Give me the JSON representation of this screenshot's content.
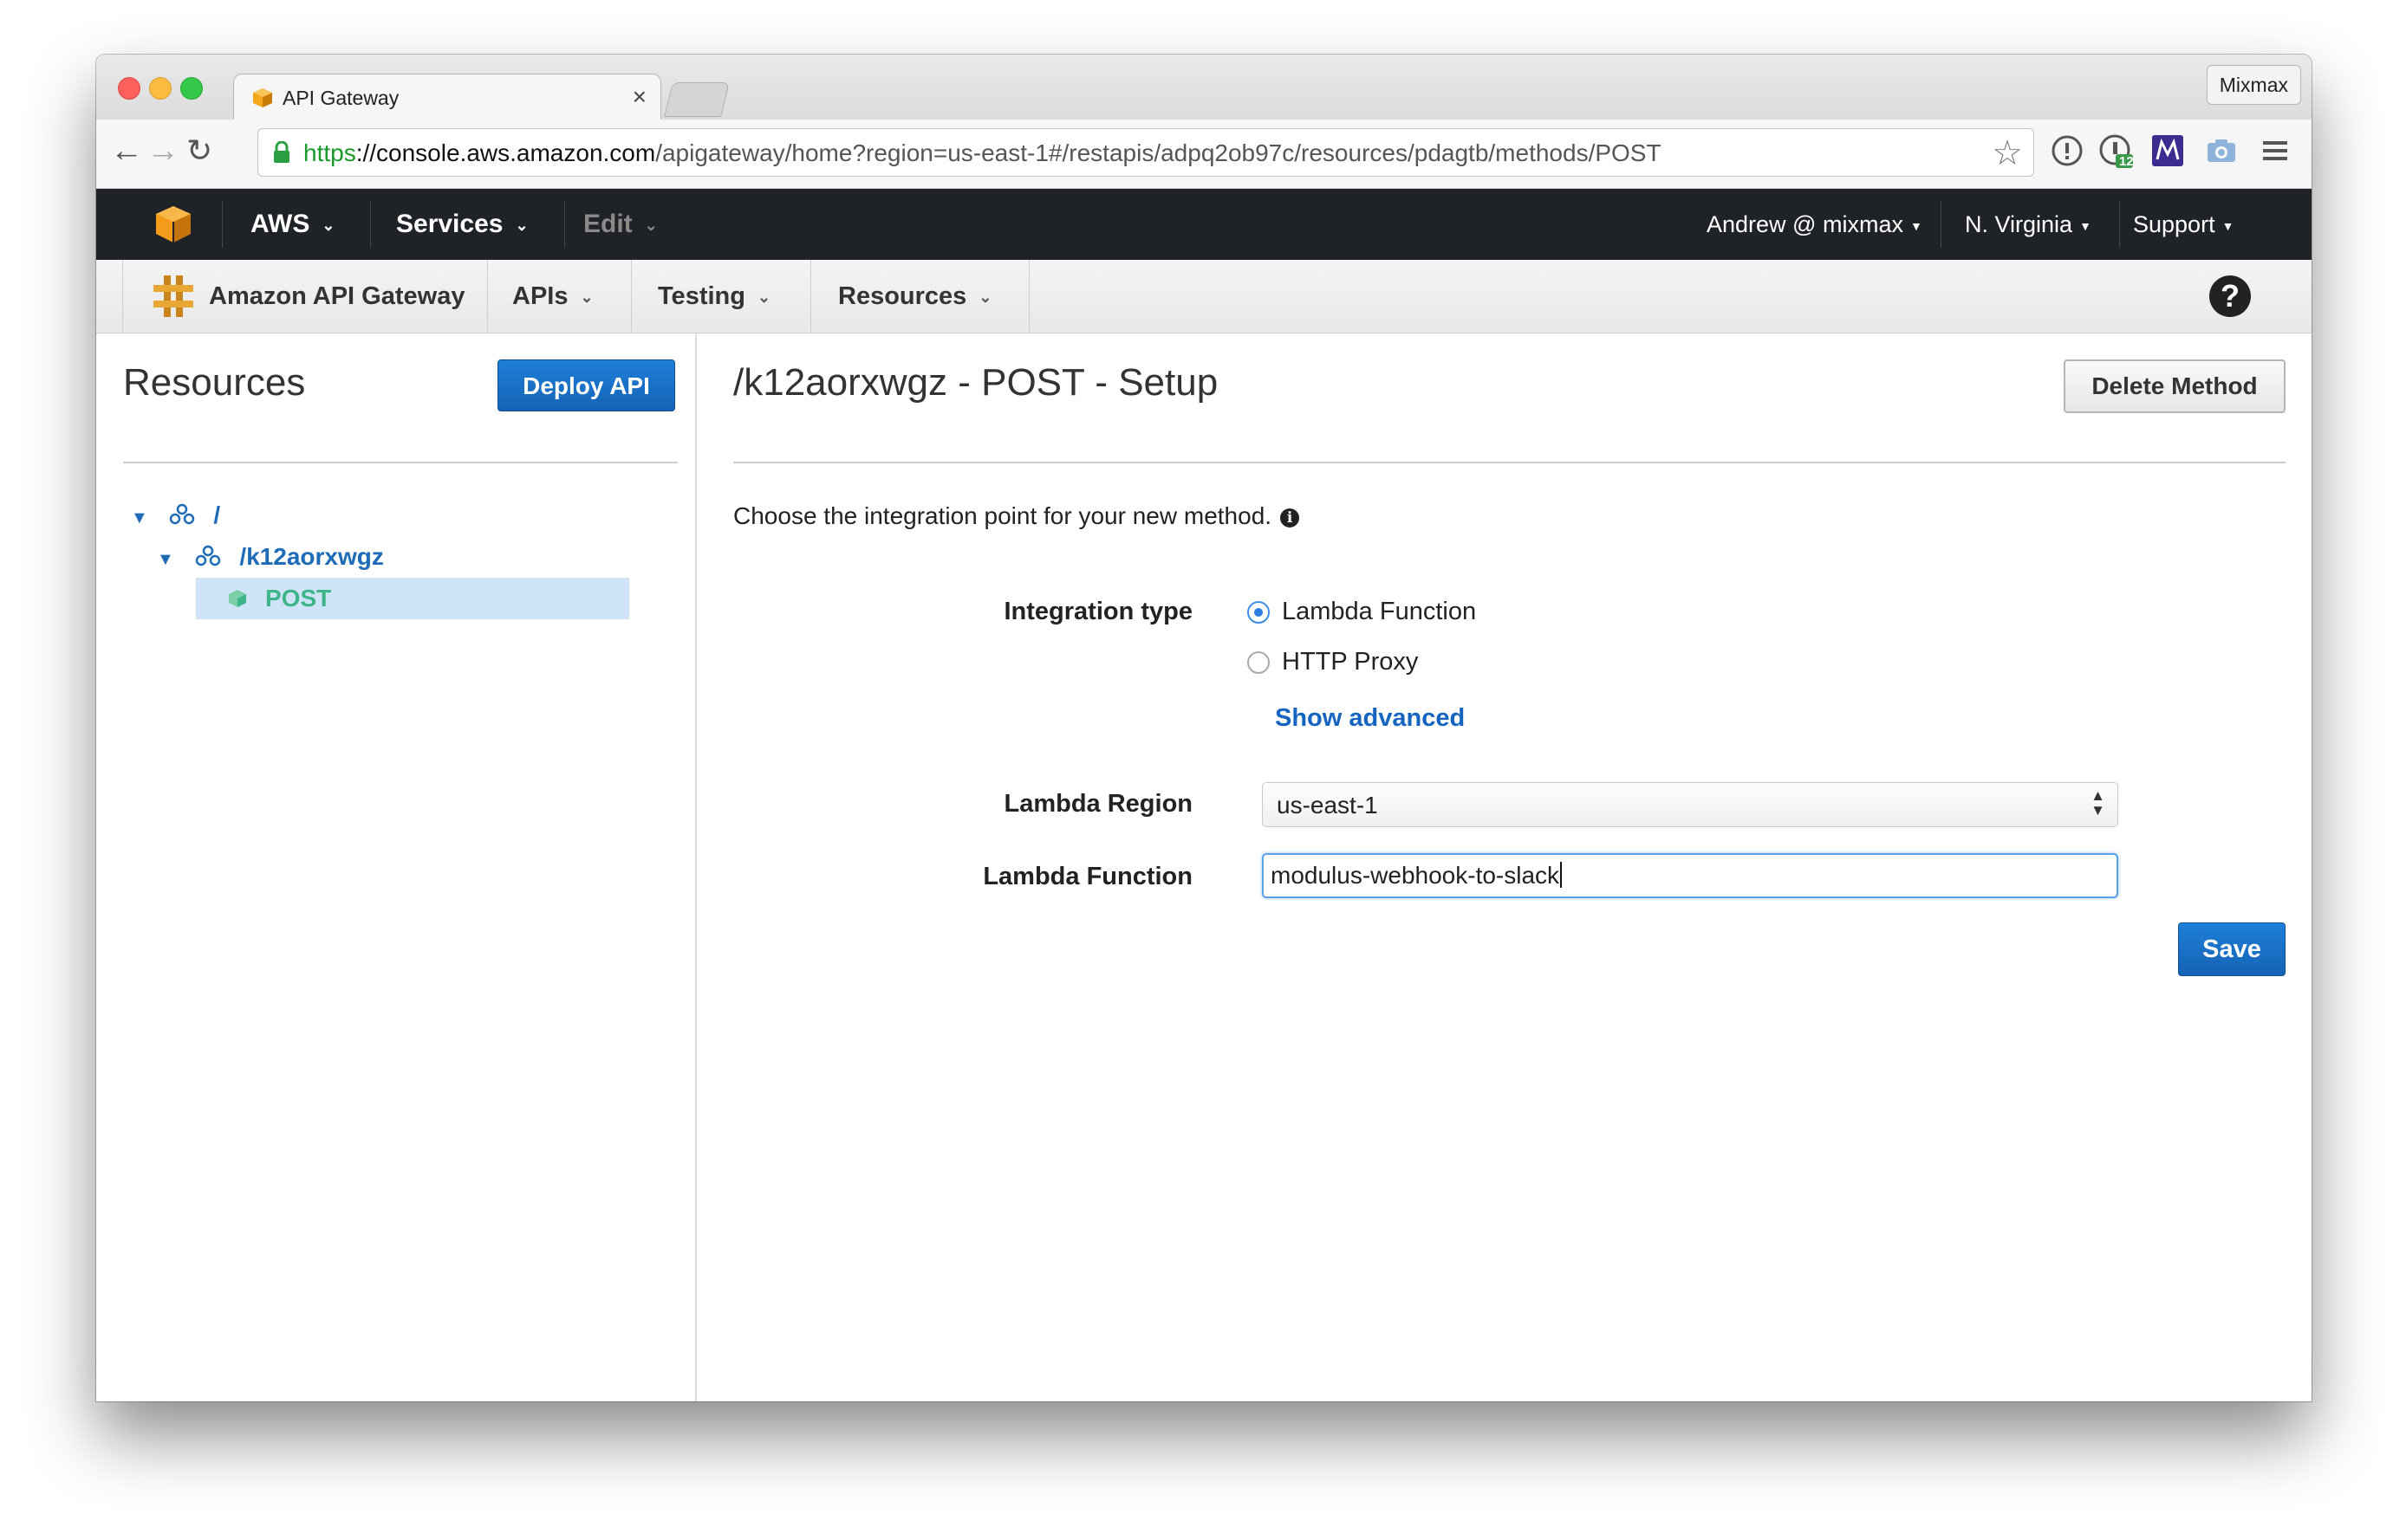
{
  "browser": {
    "tab_title": "API Gateway",
    "tab_close": "×",
    "profile_name": "Mixmax",
    "url_scheme": "https",
    "url_host": "://console.aws.amazon.com",
    "url_path": "/apigateway/home?region=us-east-1#/restapis/adpq2ob97c/resources/pdagtb/methods/POST",
    "extension_badge": "12"
  },
  "aws_header": {
    "brand": "AWS",
    "services": "Services",
    "edit": "Edit",
    "account": "Andrew @ mixmax",
    "region": "N. Virginia",
    "support": "Support"
  },
  "sub_nav": {
    "product": "Amazon API Gateway",
    "apis": "APIs",
    "testing": "Testing",
    "resources": "Resources",
    "help": "?"
  },
  "left_panel": {
    "title": "Resources",
    "deploy_label": "Deploy API",
    "tree": [
      {
        "label": "/"
      },
      {
        "label": "/k12aorxwgz"
      },
      {
        "label": "POST"
      }
    ]
  },
  "main": {
    "title": "/k12aorxwgz - POST - Setup",
    "delete_label": "Delete Method",
    "intro": "Choose the integration point for your new method.",
    "integration_type_label": "Integration type",
    "options": [
      "Lambda Function",
      "HTTP Proxy"
    ],
    "selected_option": "Lambda Function",
    "show_advanced": "Show advanced",
    "lambda_region_label": "Lambda Region",
    "lambda_region_value": "us-east-1",
    "lambda_function_label": "Lambda Function",
    "lambda_function_value": "modulus-webhook-to-slack",
    "save_label": "Save"
  },
  "colors": {
    "aws_bar": "#1f2327",
    "primary_button": "#1a6fc7",
    "link": "#1565c0",
    "tree_selected": "#cfe4f7",
    "tree_post": "#3eb489"
  }
}
